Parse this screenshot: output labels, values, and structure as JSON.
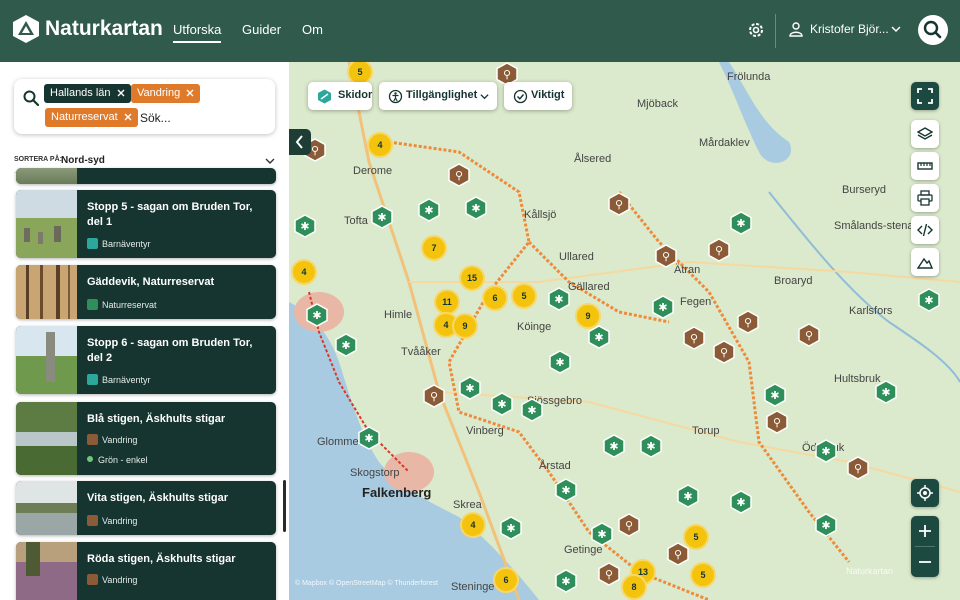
{
  "header": {
    "brand": "Naturkartan",
    "nav": [
      "Utforska",
      "Guider",
      "Om"
    ],
    "active_nav": "Utforska",
    "user_name": "Kristofer Björ...",
    "icons": {
      "settings": "gear-icon",
      "user": "user-icon",
      "search": "search-icon"
    }
  },
  "search": {
    "chips": [
      {
        "label": "Hallands län",
        "color": "#163530"
      },
      {
        "label": "Vandring",
        "color": "#e07a2b"
      },
      {
        "label": "Naturreservat",
        "color": "#e07a2b"
      }
    ],
    "placeholder": "Sök..."
  },
  "sort": {
    "label": "SORTERA PÅ:",
    "value": "Nord-syd"
  },
  "results": [
    {
      "title": "Stopp 5 - sagan om Bruden Tor, del 1",
      "category": "Barnäventyr",
      "category_color": "#2ba89b"
    },
    {
      "title": "Gäddevik, Naturreservat",
      "category": "Naturreservat",
      "category_color": "#2e8f5a"
    },
    {
      "title": "Stopp 6 - sagan om Bruden Tor, del 2",
      "category": "Barnäventyr",
      "category_color": "#2ba89b"
    },
    {
      "title": "Blå stigen, Äskhults stigar",
      "category": "Vandring",
      "category_color": "#8b5a36",
      "difficulty": "Grön - enkel"
    },
    {
      "title": "Vita stigen, Äskhults stigar",
      "category": "Vandring",
      "category_color": "#8b5a36"
    },
    {
      "title": "Röda stigen, Äskhults stigar",
      "category": "Vandring",
      "category_color": "#8b5a36"
    }
  ],
  "map_filters": [
    {
      "label": "Skidor",
      "icon": "ski-icon"
    },
    {
      "label": "Tillgänglighet",
      "icon": "accessibility-icon"
    },
    {
      "label": "Viktigt",
      "icon": "check-circle-icon"
    }
  ],
  "map_labels": [
    "Frölunda",
    "Mjöback",
    "Mårdaklev",
    "Ålsered",
    "Kållsjö",
    "Derome",
    "Burseryd",
    "Tofta",
    "Smålands-stenar",
    "Ullared",
    "Gällared",
    "Ätran",
    "Broaryd",
    "Fegen",
    "Himle",
    "Karlsfors",
    "Köinge",
    "Tvååker",
    "Hultsbruk",
    "Sjössgebro",
    "Torup",
    "Glommen",
    "Skogstorp",
    "Falkenberg",
    "Ödebruk",
    "Årstad",
    "Skrea",
    "Getinge",
    "Steninge",
    "Vinberg"
  ],
  "clusters": [
    "5",
    "4",
    "7",
    "4",
    "15",
    "11",
    "6",
    "5",
    "9",
    "4",
    "9",
    "4",
    "5",
    "5",
    "13",
    "8",
    "6"
  ],
  "attribution": "© Mapbox © OpenStreetMap © Thunderforest",
  "watermark": "Naturkartan"
}
